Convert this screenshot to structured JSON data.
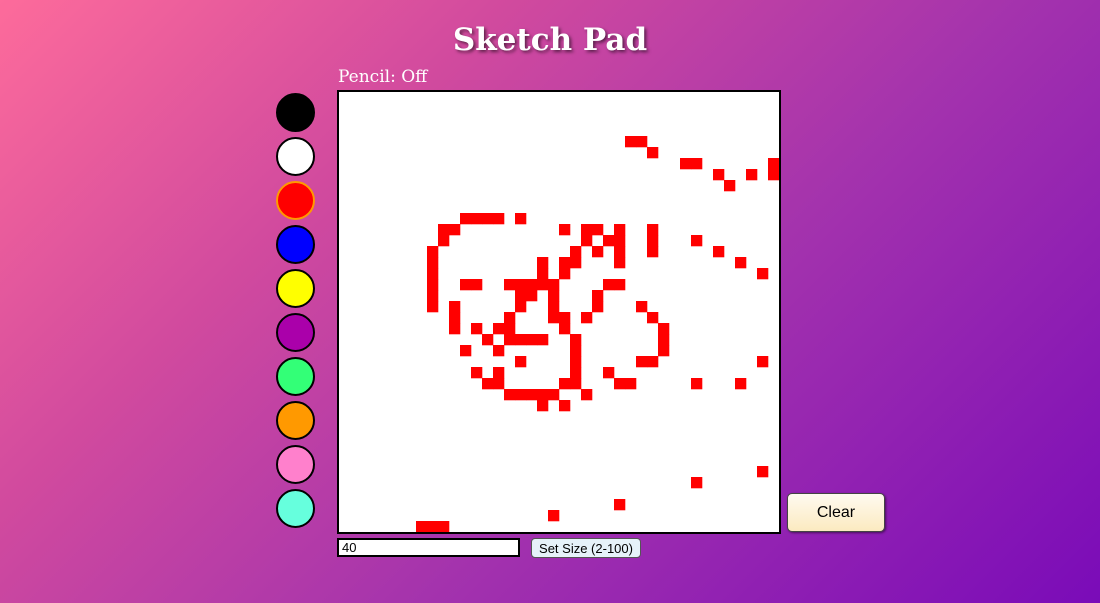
{
  "header": {
    "title": "Sketch Pad"
  },
  "status": {
    "pencil": "Pencil: Off"
  },
  "palette": {
    "colors": [
      {
        "name": "black",
        "hex": "#000000"
      },
      {
        "name": "white",
        "hex": "#ffffff"
      },
      {
        "name": "red",
        "hex": "#ff0000"
      },
      {
        "name": "blue",
        "hex": "#0000ff"
      },
      {
        "name": "yellow",
        "hex": "#ffff00"
      },
      {
        "name": "purple",
        "hex": "#aa00aa"
      },
      {
        "name": "green",
        "hex": "#33ff77"
      },
      {
        "name": "orange",
        "hex": "#ff9900"
      },
      {
        "name": "pink",
        "hex": "#ff80cc"
      },
      {
        "name": "aqua",
        "hex": "#66ffdd"
      }
    ],
    "selected": "red",
    "selected_border": "#ff9900"
  },
  "grid": {
    "size": 40,
    "background": "#ffffff",
    "ink": "#ff0000",
    "painted_cells": [
      [
        26,
        4
      ],
      [
        27,
        4
      ],
      [
        28,
        5
      ],
      [
        31,
        6
      ],
      [
        32,
        6
      ],
      [
        39,
        6
      ],
      [
        34,
        7
      ],
      [
        37,
        7
      ],
      [
        39,
        7
      ],
      [
        35,
        8
      ],
      [
        11,
        11
      ],
      [
        12,
        11
      ],
      [
        13,
        11
      ],
      [
        14,
        11
      ],
      [
        16,
        11
      ],
      [
        9,
        12
      ],
      [
        10,
        12
      ],
      [
        20,
        12
      ],
      [
        22,
        12
      ],
      [
        23,
        12
      ],
      [
        25,
        12
      ],
      [
        28,
        12
      ],
      [
        9,
        13
      ],
      [
        22,
        13
      ],
      [
        24,
        13
      ],
      [
        25,
        13
      ],
      [
        28,
        13
      ],
      [
        32,
        13
      ],
      [
        8,
        14
      ],
      [
        21,
        14
      ],
      [
        23,
        14
      ],
      [
        25,
        14
      ],
      [
        28,
        14
      ],
      [
        34,
        14
      ],
      [
        8,
        15
      ],
      [
        18,
        15
      ],
      [
        20,
        15
      ],
      [
        21,
        15
      ],
      [
        25,
        15
      ],
      [
        36,
        15
      ],
      [
        8,
        16
      ],
      [
        18,
        16
      ],
      [
        20,
        16
      ],
      [
        38,
        16
      ],
      [
        8,
        17
      ],
      [
        11,
        17
      ],
      [
        12,
        17
      ],
      [
        15,
        17
      ],
      [
        16,
        17
      ],
      [
        17,
        17
      ],
      [
        18,
        17
      ],
      [
        19,
        17
      ],
      [
        24,
        17
      ],
      [
        25,
        17
      ],
      [
        8,
        18
      ],
      [
        16,
        18
      ],
      [
        17,
        18
      ],
      [
        19,
        18
      ],
      [
        23,
        18
      ],
      [
        8,
        19
      ],
      [
        10,
        19
      ],
      [
        16,
        19
      ],
      [
        19,
        19
      ],
      [
        23,
        19
      ],
      [
        27,
        19
      ],
      [
        10,
        20
      ],
      [
        15,
        20
      ],
      [
        19,
        20
      ],
      [
        20,
        20
      ],
      [
        22,
        20
      ],
      [
        28,
        20
      ],
      [
        10,
        21
      ],
      [
        12,
        21
      ],
      [
        14,
        21
      ],
      [
        15,
        21
      ],
      [
        20,
        21
      ],
      [
        29,
        21
      ],
      [
        13,
        22
      ],
      [
        15,
        22
      ],
      [
        16,
        22
      ],
      [
        17,
        22
      ],
      [
        18,
        22
      ],
      [
        21,
        22
      ],
      [
        29,
        22
      ],
      [
        11,
        23
      ],
      [
        14,
        23
      ],
      [
        21,
        23
      ],
      [
        29,
        23
      ],
      [
        16,
        24
      ],
      [
        21,
        24
      ],
      [
        27,
        24
      ],
      [
        28,
        24
      ],
      [
        38,
        24
      ],
      [
        12,
        25
      ],
      [
        14,
        25
      ],
      [
        21,
        25
      ],
      [
        24,
        25
      ],
      [
        13,
        26
      ],
      [
        14,
        26
      ],
      [
        20,
        26
      ],
      [
        21,
        26
      ],
      [
        25,
        26
      ],
      [
        26,
        26
      ],
      [
        32,
        26
      ],
      [
        36,
        26
      ],
      [
        15,
        27
      ],
      [
        16,
        27
      ],
      [
        17,
        27
      ],
      [
        18,
        27
      ],
      [
        19,
        27
      ],
      [
        22,
        27
      ],
      [
        18,
        28
      ],
      [
        20,
        28
      ],
      [
        38,
        34
      ],
      [
        32,
        35
      ],
      [
        25,
        37
      ],
      [
        19,
        38
      ],
      [
        7,
        39
      ],
      [
        8,
        39
      ],
      [
        9,
        39
      ]
    ]
  },
  "controls": {
    "clear_label": "Clear",
    "size_value": "40",
    "size_button_label": "Set Size (2-100)"
  }
}
